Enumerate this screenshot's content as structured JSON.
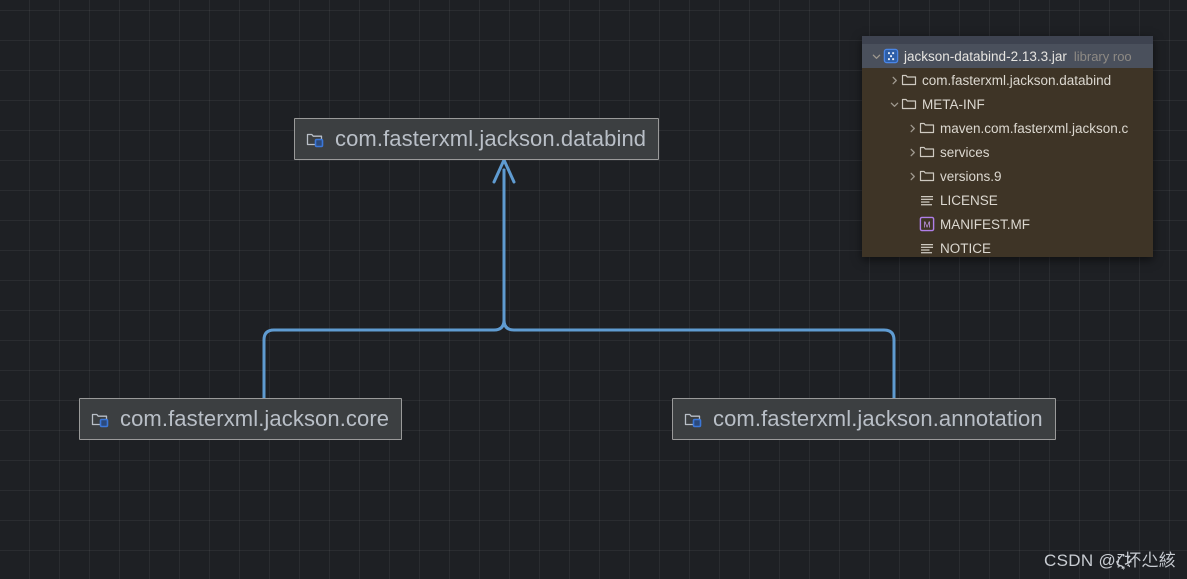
{
  "canvas": {
    "background_color": "#1e2024",
    "grid_color": "#2c2f34",
    "grid_size": 30
  },
  "diagram": {
    "type": "dependency-graph",
    "edge_color": "#6a9fd0",
    "node_background": "#3c3f41",
    "node_border": "#9a9a9a",
    "node_text_color": "#b9bfc7",
    "nodes": [
      {
        "id": "databind",
        "label": "com.fasterxml.jackson.databind",
        "icon": "package-icon"
      },
      {
        "id": "core",
        "label": "com.fasterxml.jackson.core",
        "icon": "package-icon"
      },
      {
        "id": "annotation",
        "label": "com.fasterxml.jackson.annotation",
        "icon": "package-icon"
      }
    ],
    "edges": [
      {
        "from": "core",
        "to": "databind",
        "arrow": "up"
      },
      {
        "from": "annotation",
        "to": "databind",
        "arrow": "up"
      }
    ]
  },
  "tree_panel": {
    "background_color": "#3e3426",
    "selected_row_color": "#4a505c",
    "rows": [
      {
        "indent": 0,
        "twisty": "chevron-down-icon",
        "icon": "jar-file-icon",
        "label": "jackson-databind-2.13.3.jar",
        "tag": "library roo",
        "selected": true
      },
      {
        "indent": 1,
        "twisty": "chevron-right-icon",
        "icon": "folder-icon",
        "label": "com.fasterxml.jackson.databind",
        "tag": "",
        "selected": false
      },
      {
        "indent": 1,
        "twisty": "chevron-down-icon",
        "icon": "folder-icon",
        "label": "META-INF",
        "tag": "",
        "selected": false
      },
      {
        "indent": 2,
        "twisty": "chevron-right-icon",
        "icon": "folder-icon",
        "label": "maven.com.fasterxml.jackson.c",
        "tag": "",
        "selected": false
      },
      {
        "indent": 2,
        "twisty": "chevron-right-icon",
        "icon": "folder-icon",
        "label": "services",
        "tag": "",
        "selected": false
      },
      {
        "indent": 2,
        "twisty": "chevron-right-icon",
        "icon": "folder-icon",
        "label": "versions.9",
        "tag": "",
        "selected": false
      },
      {
        "indent": 2,
        "twisty": "",
        "icon": "text-file-icon",
        "label": "LICENSE",
        "tag": "",
        "selected": false
      },
      {
        "indent": 2,
        "twisty": "",
        "icon": "manifest-file-icon",
        "label": "MANIFEST.MF",
        "tag": "",
        "selected": false
      },
      {
        "indent": 2,
        "twisty": "",
        "icon": "text-file-icon",
        "label": "NOTICE",
        "tag": "",
        "selected": false
      }
    ]
  },
  "watermark": {
    "text": "CSDN @ζ҉҉҉҉҉҉坏尐絯"
  }
}
